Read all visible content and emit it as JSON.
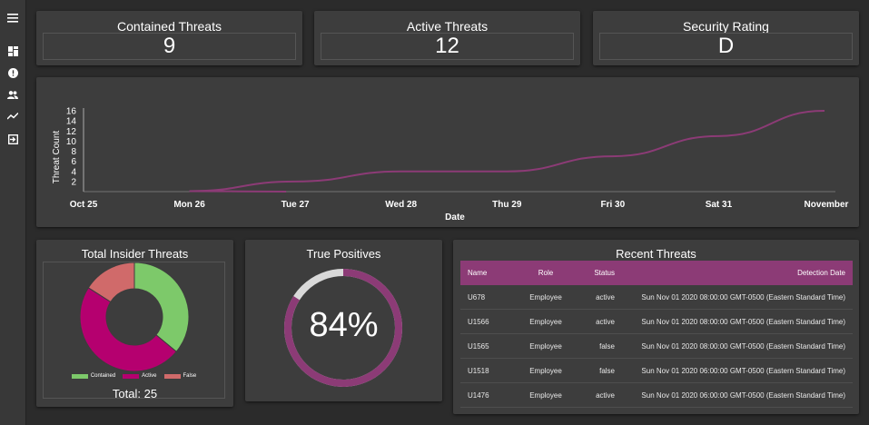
{
  "sidebar": {
    "icons": [
      "menu-icon",
      "dashboard-icon",
      "alert-icon",
      "people-icon",
      "trend-icon",
      "exit-icon"
    ]
  },
  "stats": {
    "contained": {
      "title": "Contained Threats",
      "value": "9"
    },
    "active": {
      "title": "Active Threats",
      "value": "12"
    },
    "rating": {
      "title": "Security Rating",
      "value": "D"
    }
  },
  "line_chart": {
    "ylabel": "Threat Count",
    "xlabel": "Date",
    "yticks": [
      "16",
      "14",
      "12",
      "10",
      "8",
      "6",
      "4",
      "2"
    ],
    "xticks": [
      "Oct 25",
      "Mon 26",
      "Tue 27",
      "Wed 28",
      "Thu 29",
      "Fri 30",
      "Sat 31",
      "November"
    ]
  },
  "donut": {
    "title": "Total Insider Threats",
    "total_label": "Total: 25",
    "legend": [
      "Contained",
      "Active",
      "False"
    ]
  },
  "true_positives": {
    "title": "True Positives",
    "value_label": "84%",
    "value": 0.84
  },
  "recent": {
    "title": "Recent Threats",
    "headers": {
      "name": "Name",
      "role": "Role",
      "status": "Status",
      "date": "Detection Date"
    },
    "rows": [
      {
        "name": "U678",
        "role": "Employee",
        "status": "active",
        "date": "Sun Nov 01 2020 08:00:00 GMT-0500 (Eastern Standard Time)"
      },
      {
        "name": "U1566",
        "role": "Employee",
        "status": "active",
        "date": "Sun Nov 01 2020 08:00:00 GMT-0500 (Eastern Standard Time)"
      },
      {
        "name": "U1565",
        "role": "Employee",
        "status": "false",
        "date": "Sun Nov 01 2020 08:00:00 GMT-0500 (Eastern Standard Time)"
      },
      {
        "name": "U1518",
        "role": "Employee",
        "status": "false",
        "date": "Sun Nov 01 2020 06:00:00 GMT-0500 (Eastern Standard Time)"
      },
      {
        "name": "U1476",
        "role": "Employee",
        "status": "active",
        "date": "Sun Nov 01 2020 06:00:00 GMT-0500 (Eastern Standard Time)"
      }
    ]
  },
  "colors": {
    "accent": "#8c3b76",
    "contained": "#7dc96a",
    "active": "#b5006f",
    "false": "#d06a6a",
    "ring_rest": "#d9d9d9"
  },
  "chart_data": [
    {
      "type": "line",
      "x": [
        "Oct 25",
        "Mon 26",
        "Tue 27",
        "Wed 28",
        "Thu 29",
        "Fri 30",
        "Sat 31",
        "November"
      ],
      "series": [
        {
          "values": [
            0,
            0,
            2,
            4,
            4,
            7,
            11,
            16
          ]
        }
      ],
      "xlabel": "Date",
      "ylabel": "Threat Count",
      "ylim": [
        0,
        16
      ],
      "grid": false
    },
    {
      "type": "pie",
      "title": "Total Insider Threats",
      "categories": [
        "Contained",
        "Active",
        "False"
      ],
      "values": [
        9,
        12,
        4
      ],
      "legend": "bottom"
    }
  ]
}
